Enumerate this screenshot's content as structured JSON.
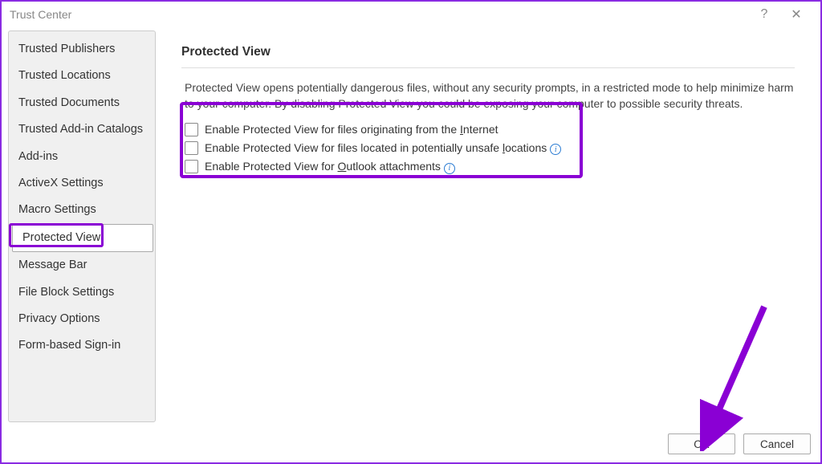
{
  "title": "Trust Center",
  "sidebar": {
    "items": [
      {
        "label": "Trusted Publishers",
        "active": false
      },
      {
        "label": "Trusted Locations",
        "active": false
      },
      {
        "label": "Trusted Documents",
        "active": false
      },
      {
        "label": "Trusted Add-in Catalogs",
        "active": false
      },
      {
        "label": "Add-ins",
        "active": false
      },
      {
        "label": "ActiveX Settings",
        "active": false
      },
      {
        "label": "Macro Settings",
        "active": false
      },
      {
        "label": "Protected View",
        "active": true
      },
      {
        "label": "Message Bar",
        "active": false
      },
      {
        "label": "File Block Settings",
        "active": false
      },
      {
        "label": "Privacy Options",
        "active": false
      },
      {
        "label": "Form-based Sign-in",
        "active": false
      }
    ]
  },
  "content": {
    "heading": "Protected View",
    "description": "Protected View opens potentially dangerous files, without any security prompts, in a restricted mode to help minimize harm to your computer. By disabling Protected View you could be exposing your computer to possible security threats.",
    "options": [
      {
        "label_pre": "Enable Protected View for files originating from the ",
        "underline": "I",
        "label_post": "nternet",
        "info": false,
        "checked": false
      },
      {
        "label_pre": "Enable Protected View for files located in potentially unsafe ",
        "underline": "l",
        "label_post": "ocations",
        "info": true,
        "checked": false
      },
      {
        "label_pre": "Enable Protected View for ",
        "underline": "O",
        "label_post": "utlook attachments",
        "info": true,
        "checked": false
      }
    ]
  },
  "footer": {
    "ok": "OK",
    "cancel": "Cancel"
  }
}
